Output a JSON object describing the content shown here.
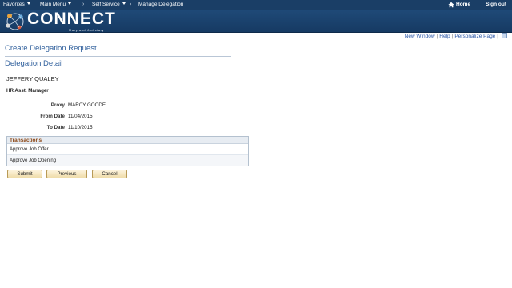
{
  "nav": {
    "favorites": "Favorites",
    "main_menu": "Main Menu",
    "breadcrumb_sep": "›",
    "self_service": "Self Service",
    "manage_delegation": "Manage Delegation",
    "home": "Home",
    "sign_out": "Sign out"
  },
  "banner": {
    "logo_text": "CONNECT",
    "logo_subtitle": "Maryland Judiciary"
  },
  "page_links": {
    "new_window": "New Window",
    "help": "Help",
    "personalize_page": "Personalize Page",
    "sep": "|"
  },
  "page": {
    "title": "Create Delegation Request",
    "section_title": "Delegation Detail",
    "employee_name": "JEFFERY QUALEY",
    "job_title": "HR Asst. Manager"
  },
  "fields": {
    "proxy_label": "Proxy",
    "proxy_value": "MARCY GOODE",
    "from_date_label": "From Date",
    "from_date_value": "11/04/2015",
    "to_date_label": "To Date",
    "to_date_value": "11/10/2015"
  },
  "transactions": {
    "header": "Transactions",
    "rows": [
      "Approve Job Offer",
      "Approve Job Opening"
    ]
  },
  "buttons": {
    "submit": "Submit",
    "previous": "Previous",
    "cancel": "Cancel"
  },
  "colors": {
    "nav_bg": "#1a3e66",
    "banner_bg": "#1f4a78",
    "title_blue": "#2f5f9c",
    "transactions_header": "#8b4513",
    "button_bg": "#efdcaa"
  }
}
